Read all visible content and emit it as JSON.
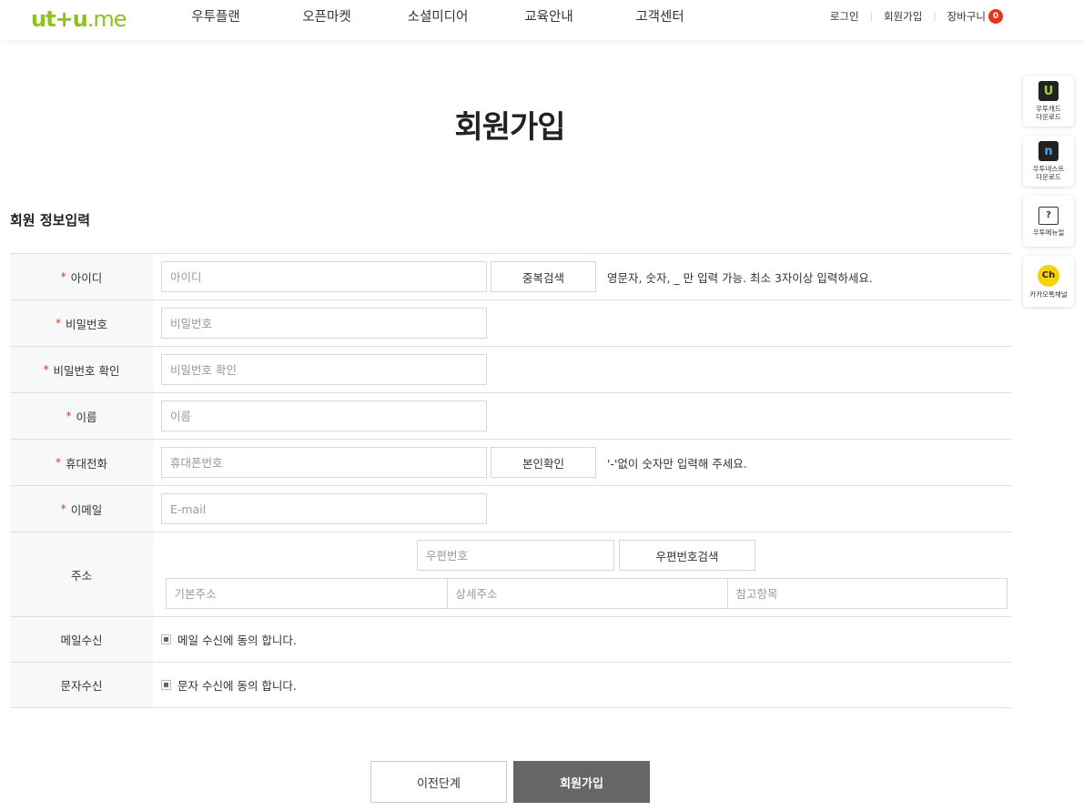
{
  "header": {
    "logo_main": "ut+u",
    "logo_suffix": ".me",
    "nav": [
      "우투플랜",
      "오픈마켓",
      "소셜미디어",
      "교육안내",
      "고객센터"
    ],
    "util": {
      "login": "로그인",
      "signup": "회원가입",
      "cart": "장바구니",
      "cart_count": "0"
    }
  },
  "page_title": "회원가입",
  "section_title": "회원 정보입력",
  "required_mark": "*",
  "form": {
    "id": {
      "label": "아이디",
      "placeholder": "아이디",
      "button": "중복검색",
      "hint": "영문자, 숫자, _ 만 입력 가능. 최소 3자이상 입력하세요."
    },
    "password": {
      "label": "비밀번호",
      "placeholder": "비밀번호"
    },
    "password_confirm": {
      "label": "비밀번호 확인",
      "placeholder": "비밀번호 확인"
    },
    "name": {
      "label": "이름",
      "placeholder": "이름"
    },
    "phone": {
      "label": "휴대전화",
      "placeholder": "휴대폰번호",
      "button": "본인확인",
      "hint": "'-'없이 숫자만 입력해 주세요."
    },
    "email": {
      "label": "이메일",
      "placeholder": "E-mail"
    },
    "address": {
      "label": "주소",
      "zip_placeholder": "우편번호",
      "zip_button": "우편번호검색",
      "base_placeholder": "기본주소",
      "detail_placeholder": "상세주소",
      "extra_placeholder": "참고항목"
    },
    "mail_receive": {
      "label": "메일수신",
      "text": "메일 수신에 동의 합니다."
    },
    "sms_receive": {
      "label": "문자수신",
      "text": "문자 수신에 동의 합니다."
    }
  },
  "buttons": {
    "prev": "이전단계",
    "join": "회원가입"
  },
  "quick_menu": [
    {
      "icon": "U",
      "label": "우투캐드\n다운로드"
    },
    {
      "icon": "n",
      "label": "우투네스트\n다운로드"
    },
    {
      "icon": "?",
      "label": "우투메뉴얼"
    },
    {
      "icon": "Ch",
      "label": "카카오톡채널"
    }
  ],
  "colors": {
    "brand": "#8dc21f",
    "required": "#e8321c",
    "join_button": "#666666"
  }
}
